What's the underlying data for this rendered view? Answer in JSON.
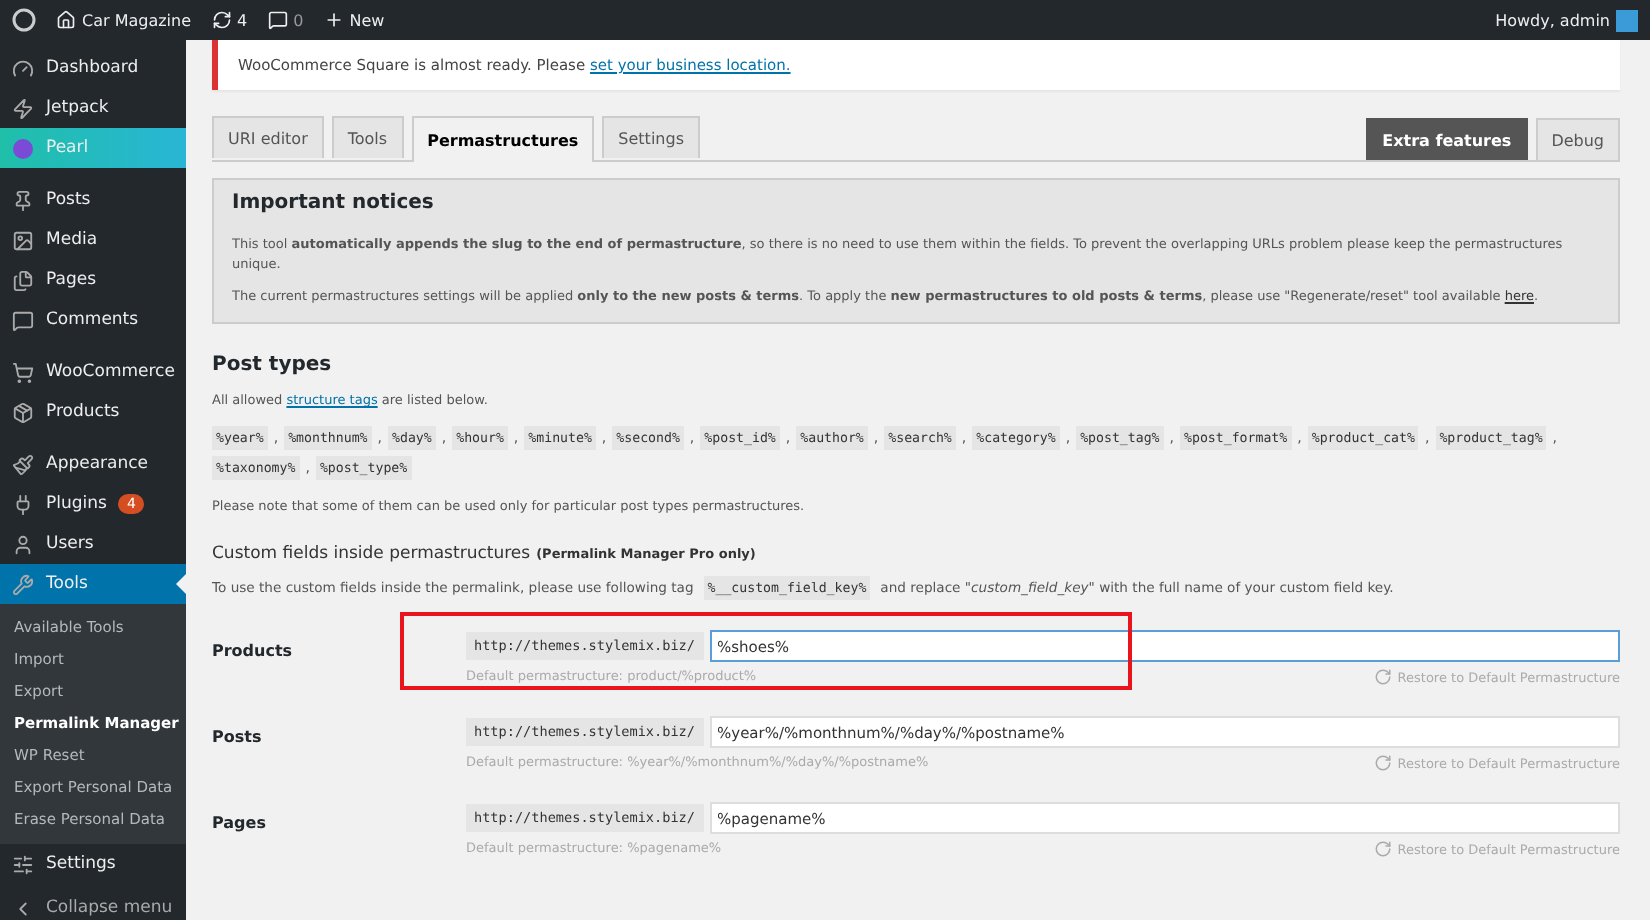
{
  "admin_bar": {
    "site": "Car Magazine",
    "updates": "4",
    "comments": "0",
    "new": "New",
    "greeting": "Howdy, admin"
  },
  "sidebar": {
    "groups": [
      [
        {
          "label": "Dashboard",
          "selected": false,
          "highlighted": false
        },
        {
          "label": "Jetpack",
          "selected": false,
          "highlighted": false
        },
        {
          "label": "Pearl",
          "selected": false,
          "highlighted": true
        }
      ],
      [
        {
          "label": "Posts",
          "selected": false,
          "highlighted": false
        },
        {
          "label": "Media",
          "selected": false,
          "highlighted": false
        },
        {
          "label": "Pages",
          "selected": false,
          "highlighted": false
        },
        {
          "label": "Comments",
          "selected": false,
          "highlighted": false
        }
      ],
      [
        {
          "label": "WooCommerce",
          "selected": false,
          "highlighted": false
        },
        {
          "label": "Products",
          "selected": false,
          "highlighted": false
        }
      ],
      [
        {
          "label": "Appearance",
          "selected": false,
          "highlighted": false
        },
        {
          "label": "Plugins",
          "selected": false,
          "highlighted": false,
          "badge": "4"
        },
        {
          "label": "Users",
          "selected": false,
          "highlighted": false
        },
        {
          "label": "Tools",
          "selected": true,
          "highlighted": false,
          "submenu": [
            {
              "label": "Available Tools",
              "selected": false
            },
            {
              "label": "Import",
              "selected": false
            },
            {
              "label": "Export",
              "selected": false
            },
            {
              "label": "Permalink Manager",
              "selected": true
            },
            {
              "label": "WP Reset",
              "selected": false
            },
            {
              "label": "Export Personal Data",
              "selected": false
            },
            {
              "label": "Erase Personal Data",
              "selected": false
            }
          ]
        },
        {
          "label": "Settings",
          "selected": false,
          "highlighted": false
        }
      ]
    ],
    "collapse": "Collapse menu"
  },
  "notice": {
    "text": "WooCommerce Square is almost ready. Please ",
    "link": "set your business location."
  },
  "tabs": [
    {
      "label": "URI editor",
      "selected": false
    },
    {
      "label": "Tools",
      "selected": false
    },
    {
      "label": "Permastructures",
      "selected": true
    },
    {
      "label": "Settings",
      "selected": false
    }
  ],
  "right_tabs": [
    {
      "label": "Extra features",
      "highlighted": true
    },
    {
      "label": "Debug",
      "highlighted": false
    }
  ],
  "important": {
    "title": "Important notices",
    "paragraphs": [
      {
        "text": "This tool **automatically appends the slug to the end of permastructure**, so there is no need to use them within the fields. To prevent the overlapping URLs problem please keep the permastructures unique."
      },
      {
        "text": "The current permastructures settings will be applied **only to the new posts & terms**. To apply the **new permastructures to old posts & terms**, please use \"Regenerate/reset\" tool available ",
        "link": "here",
        "after": "."
      }
    ]
  },
  "post_types": {
    "title": "Post types",
    "intro_before": "All allowed ",
    "intro_link": "structure tags",
    "intro_after": " are listed below.",
    "tags": [
      "%year%",
      "%monthnum%",
      "%day%",
      "%hour%",
      "%minute%",
      "%second%",
      "%post_id%",
      "%author%",
      "%search%",
      "%category%",
      "%post_tag%",
      "%post_format%",
      "%product_cat%",
      "%product_tag%",
      "%taxonomy%",
      "%post_type%"
    ],
    "tag_separator": ",",
    "note": "Please note that some of them can be used only for particular post types permastructures."
  },
  "custom_fields": {
    "title": "Custom fields inside permastructures",
    "title_note": "(Permalink Manager Pro only)",
    "text_before": "To use the custom fields inside the permalink, please use following tag",
    "tag": "%__custom_field_key%",
    "text_after": "and replace \"*custom_field_key*\" with the full name of your custom field key."
  },
  "rows": [
    {
      "label": "Products",
      "prefix": "http://themes.stylemix.biz/",
      "value": "%shoes%",
      "focused": true,
      "highlighted": true,
      "default": "Default permastructure: product/%product%",
      "restore": "Restore to Default Permastructure"
    },
    {
      "label": "Posts",
      "prefix": "http://themes.stylemix.biz/",
      "value": "%year%/%monthnum%/%day%/%postname%",
      "focused": false,
      "highlighted": false,
      "default": "Default permastructure: %year%/%monthnum%/%day%/%postname%",
      "restore": "Restore to Default Permastructure"
    },
    {
      "label": "Pages",
      "prefix": "http://themes.stylemix.biz/",
      "value": "%pagename%",
      "focused": false,
      "highlighted": false,
      "default": "Default permastructure: %pagename%",
      "restore": "Restore to Default Permastructure"
    }
  ]
}
